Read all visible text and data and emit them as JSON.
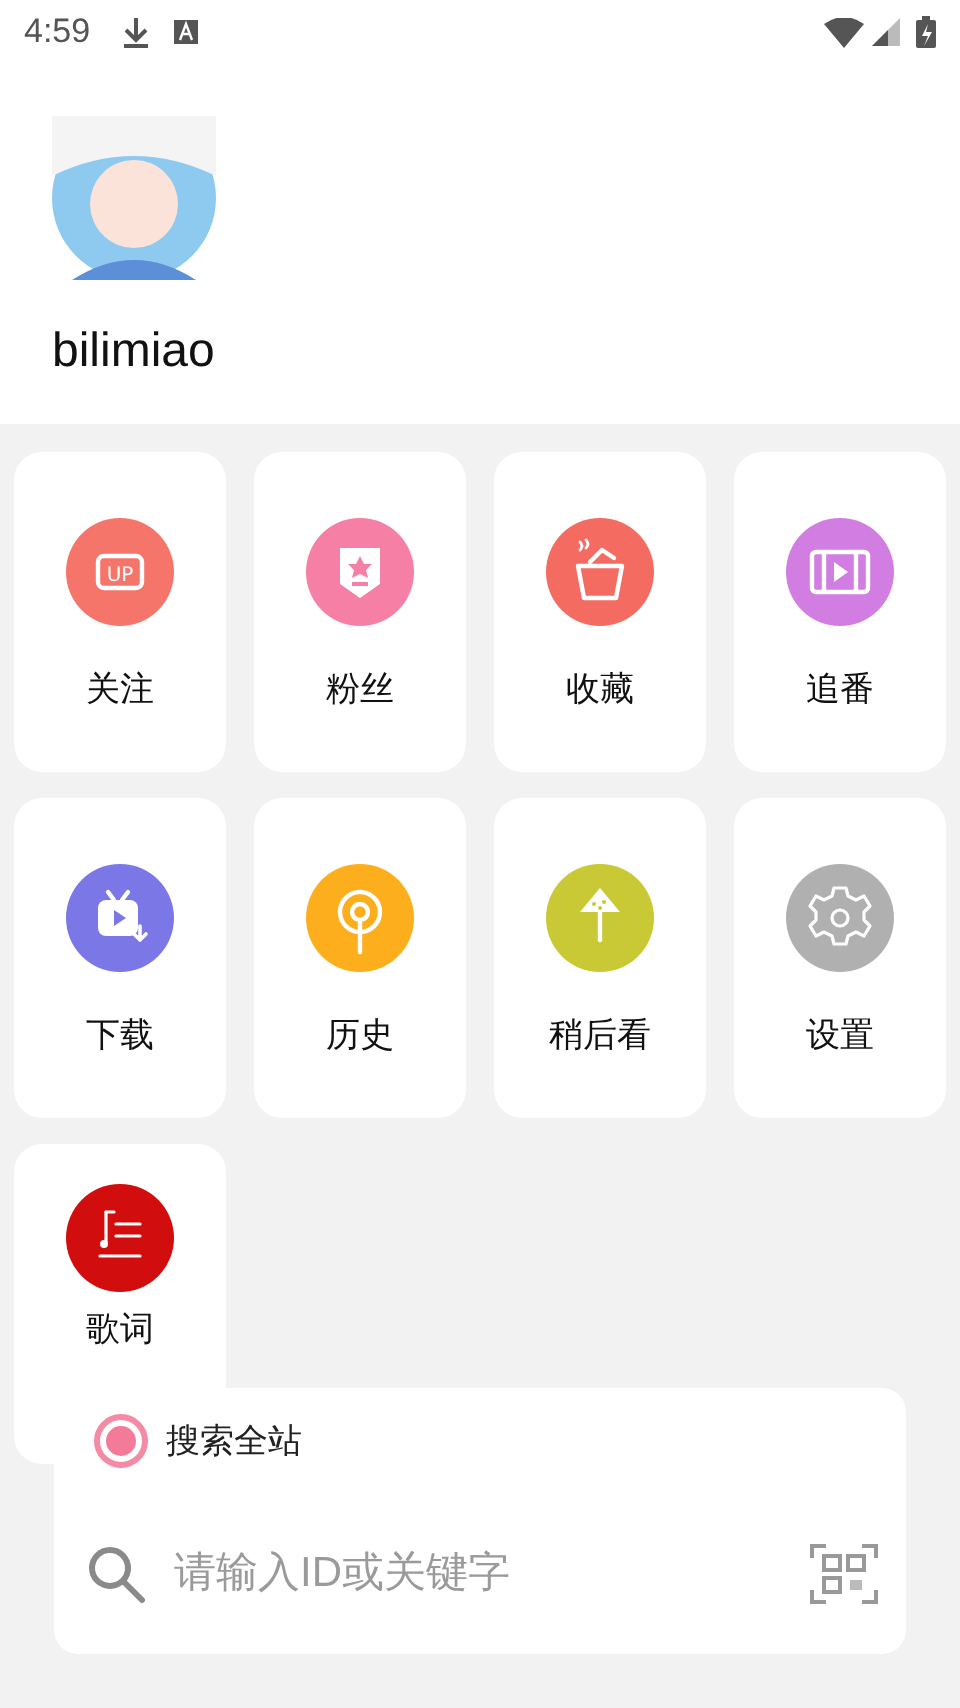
{
  "status_bar": {
    "time": "4:59"
  },
  "profile": {
    "username": "bilimiao"
  },
  "menu": [
    {
      "label": "关注",
      "kind": "up",
      "color": "#f5756a",
      "icon_text": "UP"
    },
    {
      "label": "粉丝",
      "kind": "badge",
      "color": "#f57fa5"
    },
    {
      "label": "收藏",
      "kind": "pot",
      "color": "#f46c61"
    },
    {
      "label": "追番",
      "kind": "film",
      "color": "#d27de2"
    },
    {
      "label": "下载",
      "kind": "tv",
      "color": "#7b77e6"
    },
    {
      "label": "历史",
      "kind": "antenna",
      "color": "#fdae1c"
    },
    {
      "label": "稍后看",
      "kind": "popsicle",
      "color": "#c8c934"
    },
    {
      "label": "设置",
      "kind": "gear",
      "color": "#b0b0b0"
    },
    {
      "label": "歌词",
      "kind": "lyrics",
      "color": "#d10d0d"
    }
  ],
  "search": {
    "scope": {
      "label": "搜索全站",
      "selected": true
    },
    "placeholder": "请输入ID或关键字"
  }
}
